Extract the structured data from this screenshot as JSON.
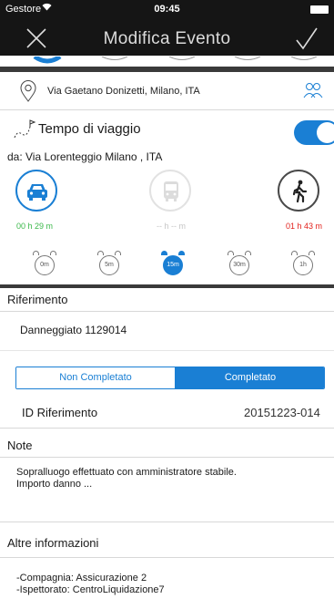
{
  "status_bar": {
    "carrier": "Gestore",
    "time": "09:45"
  },
  "navbar": {
    "title": "Modifica Evento"
  },
  "address": {
    "text": "Via Gaetano Donizetti, Milano, ITA"
  },
  "travel": {
    "label": "Tempo di viaggio",
    "toggle_on": true,
    "from": "da: Via Lorenteggio  Milano , ITA"
  },
  "modes": [
    {
      "name": "car",
      "time": "00 h 29 m"
    },
    {
      "name": "bus",
      "time": "-- h -- m"
    },
    {
      "name": "walk",
      "time": "01 h 43 m"
    }
  ],
  "alarms": [
    {
      "label": "0m",
      "selected": false
    },
    {
      "label": "5m",
      "selected": false
    },
    {
      "label": "15m",
      "selected": true
    },
    {
      "label": "30m",
      "selected": false
    },
    {
      "label": "1h",
      "selected": false
    }
  ],
  "riferimento": {
    "label": "Riferimento",
    "value": "Danneggiato 1129014"
  },
  "segmented": {
    "option_a": "Non Completato",
    "option_b": "Completato",
    "selected": "Completato"
  },
  "id_riferimento": {
    "label": "ID Riferimento",
    "value": "20151223-014"
  },
  "note": {
    "label": "Note",
    "line1": "Sopralluogo effettuato con amministratore stabile.",
    "line2": "Importo danno ..."
  },
  "altre": {
    "label": "Altre informazioni",
    "line1": "-Compagnia: Assicurazione 2",
    "line2": "-Ispettorato: CentroLiquidazione7"
  },
  "colors": {
    "accent": "#1a7fd4",
    "header_bg": "#151515",
    "green": "#3cb84b",
    "red": "#e2211c"
  }
}
